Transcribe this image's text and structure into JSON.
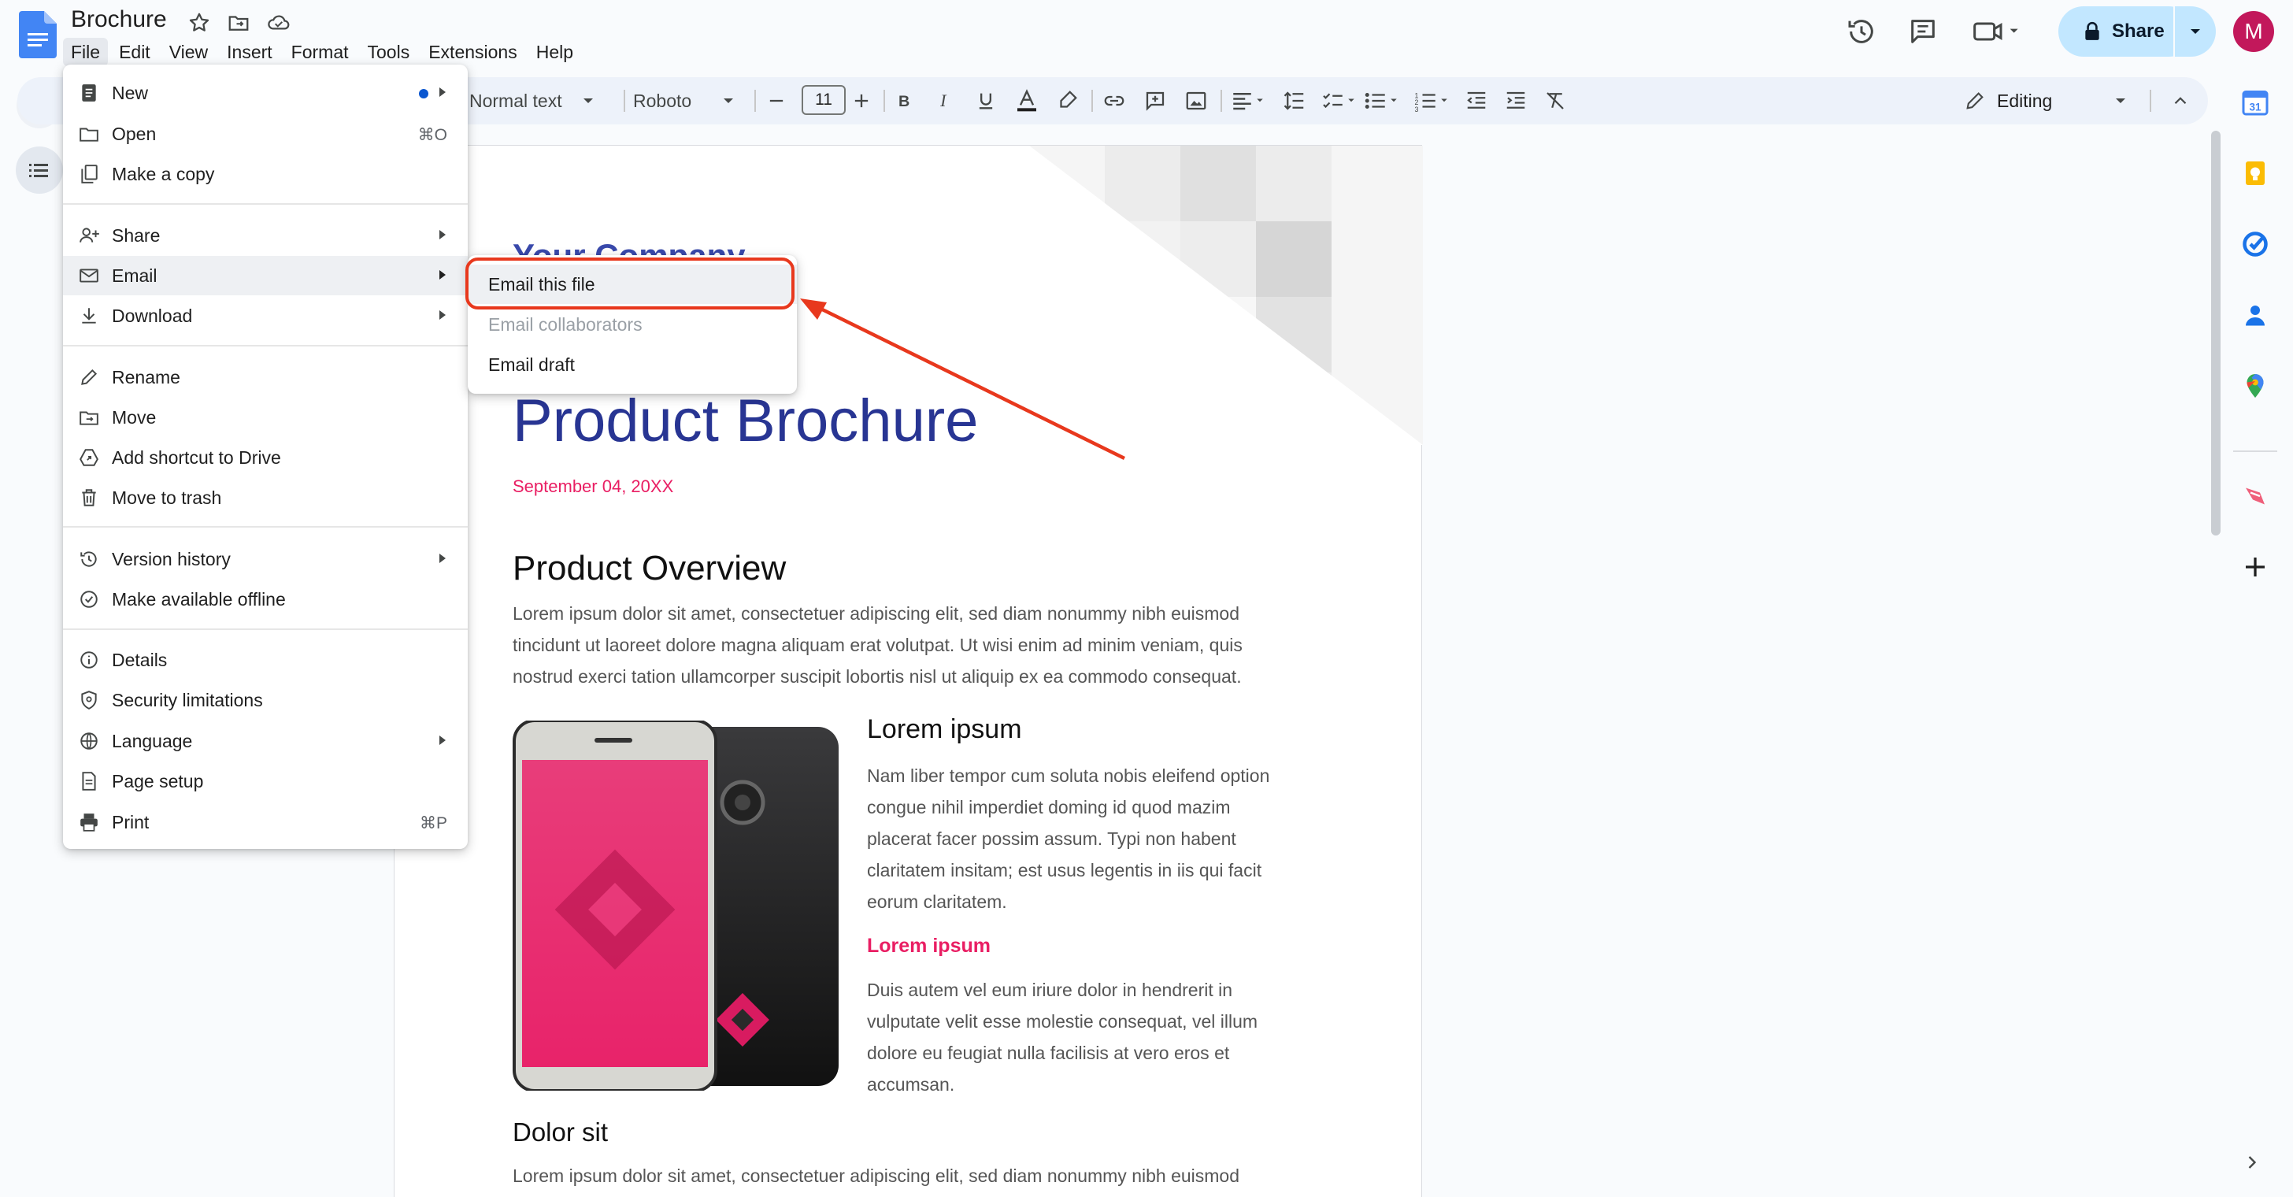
{
  "app": {
    "title": "Brochure"
  },
  "menubar": [
    "File",
    "Edit",
    "View",
    "Insert",
    "Format",
    "Tools",
    "Extensions",
    "Help"
  ],
  "share": {
    "label": "Share"
  },
  "avatar": {
    "initial": "M",
    "color": "#c2185b"
  },
  "toolbar": {
    "style": "Normal text",
    "font": "Roboto",
    "font_size": "11",
    "mode": "Editing"
  },
  "file_menu": {
    "items": [
      {
        "label": "New",
        "icon": "new-doc-icon",
        "submenu": true,
        "dot": true
      },
      {
        "label": "Open",
        "icon": "folder-icon",
        "shortcut": "⌘O"
      },
      {
        "label": "Make a copy",
        "icon": "copy-icon"
      },
      {
        "label": "Share",
        "icon": "person-add-icon",
        "submenu": true
      },
      {
        "label": "Email",
        "icon": "mail-icon",
        "submenu": true
      },
      {
        "label": "Download",
        "icon": "download-icon",
        "submenu": true
      },
      {
        "label": "Rename",
        "icon": "pencil-icon"
      },
      {
        "label": "Move",
        "icon": "move-folder-icon"
      },
      {
        "label": "Add shortcut to Drive",
        "icon": "drive-shortcut-icon"
      },
      {
        "label": "Move to trash",
        "icon": "trash-icon"
      },
      {
        "label": "Version history",
        "icon": "history-icon",
        "submenu": true
      },
      {
        "label": "Make available offline",
        "icon": "offline-icon"
      },
      {
        "label": "Details",
        "icon": "info-icon"
      },
      {
        "label": "Security limitations",
        "icon": "shield-icon"
      },
      {
        "label": "Language",
        "icon": "globe-icon",
        "submenu": true
      },
      {
        "label": "Page setup",
        "icon": "page-icon"
      },
      {
        "label": "Print",
        "icon": "printer-icon",
        "shortcut": "⌘P"
      }
    ]
  },
  "email_submenu": {
    "items": [
      {
        "label": "Email this file",
        "enabled": true
      },
      {
        "label": "Email collaborators",
        "enabled": false
      },
      {
        "label": "Email draft",
        "enabled": true
      }
    ]
  },
  "document": {
    "company": "Your Company",
    "heading": "Product Brochure",
    "date": "September 04, 20XX",
    "overview_heading": "Product Overview",
    "overview_lines": [
      "Lorem ipsum dolor sit amet, consectetuer adipiscing elit, sed diam nonummy nibh euismod",
      "tincidunt ut laoreet dolore magna aliquam erat volutpat. Ut wisi enim ad minim veniam, quis",
      "nostrud exerci tation ullamcorper suscipit lobortis nisl ut aliquip ex ea commodo consequat."
    ],
    "col_heading": "Lorem ipsum",
    "col_para_1_lines": [
      "Nam liber tempor cum soluta nobis eleifend option",
      "congue nihil imperdiet doming id quod mazim",
      "placerat facer possim assum. Typi non habent",
      "claritatem insitam; est usus legentis in iis qui facit",
      "eorum claritatem."
    ],
    "col_subheading": "Lorem ipsum",
    "col_para_2_lines": [
      "Duis autem vel eum iriure dolor in hendrerit in",
      "vulputate velit esse molestie consequat, vel illum",
      "dolore eu feugiat nulla facilisis at vero eros et",
      "accumsan."
    ],
    "dolor_heading": "Dolor sit",
    "last_line": "Lorem ipsum dolor sit amet, consectetuer adipiscing elit, sed diam nonummy nibh euismod"
  },
  "colors": {
    "accent": "#0b57d0",
    "annotation": "#e8381d",
    "brand_pink": "#e91e63",
    "heading_blue": "#283593"
  }
}
